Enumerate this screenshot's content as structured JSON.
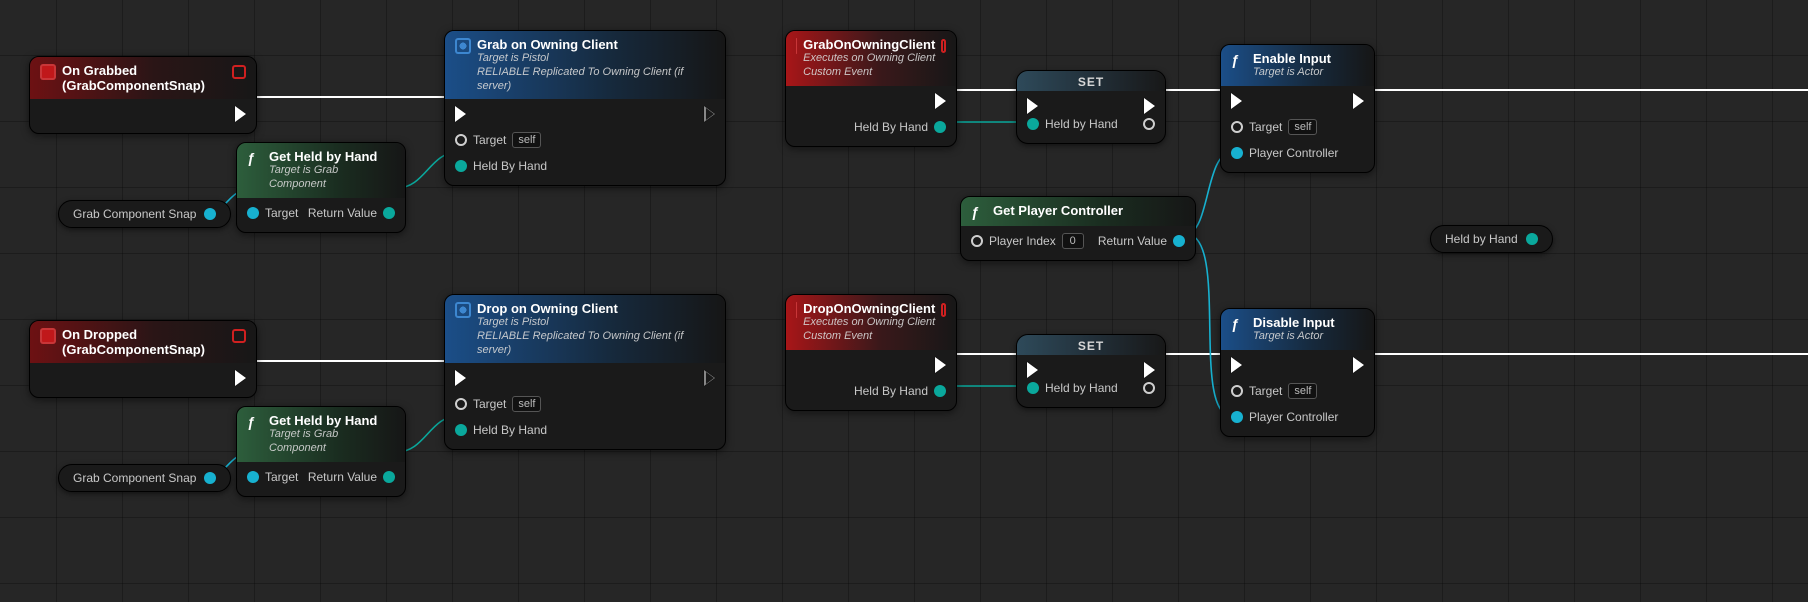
{
  "labels": {
    "self": "self",
    "target": "Target",
    "return_value": "Return Value",
    "player_controller": "Player Controller",
    "held_by_hand_pin": "Held By Hand",
    "held_by_hand_var": "Held by Hand",
    "player_index": "Player Index",
    "set": "SET"
  },
  "pills": {
    "grab_component_snap": "Grab Component Snap"
  },
  "nodes": {
    "on_grabbed": {
      "title": "On Grabbed (GrabComponentSnap)"
    },
    "on_dropped": {
      "title": "On Dropped (GrabComponentSnap)"
    },
    "get_held1": {
      "title": "Get Held by Hand",
      "sub": "Target is Grab Component"
    },
    "get_held2": {
      "title": "Get Held by Hand",
      "sub": "Target is Grab Component"
    },
    "grab_owning": {
      "title": "Grab on Owning Client",
      "sub1": "Target is Pistol",
      "sub2": "RELIABLE Replicated To Owning Client (if server)"
    },
    "drop_owning": {
      "title": "Drop on Owning Client",
      "sub1": "Target is Pistol",
      "sub2": "RELIABLE Replicated To Owning Client (if server)"
    },
    "grab_ce": {
      "title": "GrabOnOwningClient",
      "sub1": "Executes on Owning Client",
      "sub2": "Custom Event"
    },
    "drop_ce": {
      "title": "DropOnOwningClient",
      "sub1": "Executes on Owning Client",
      "sub2": "Custom Event"
    },
    "get_pc": {
      "title": "Get Player Controller",
      "player_index_value": "0"
    },
    "enable_input": {
      "title": "Enable Input",
      "sub": "Target is Actor"
    },
    "disable_input": {
      "title": "Disable Input",
      "sub": "Target is Actor"
    }
  },
  "colors": {
    "exec_wire": "#ffffff",
    "obj_wire": "#17b1d0",
    "hand_wire": "#0aa89c"
  }
}
